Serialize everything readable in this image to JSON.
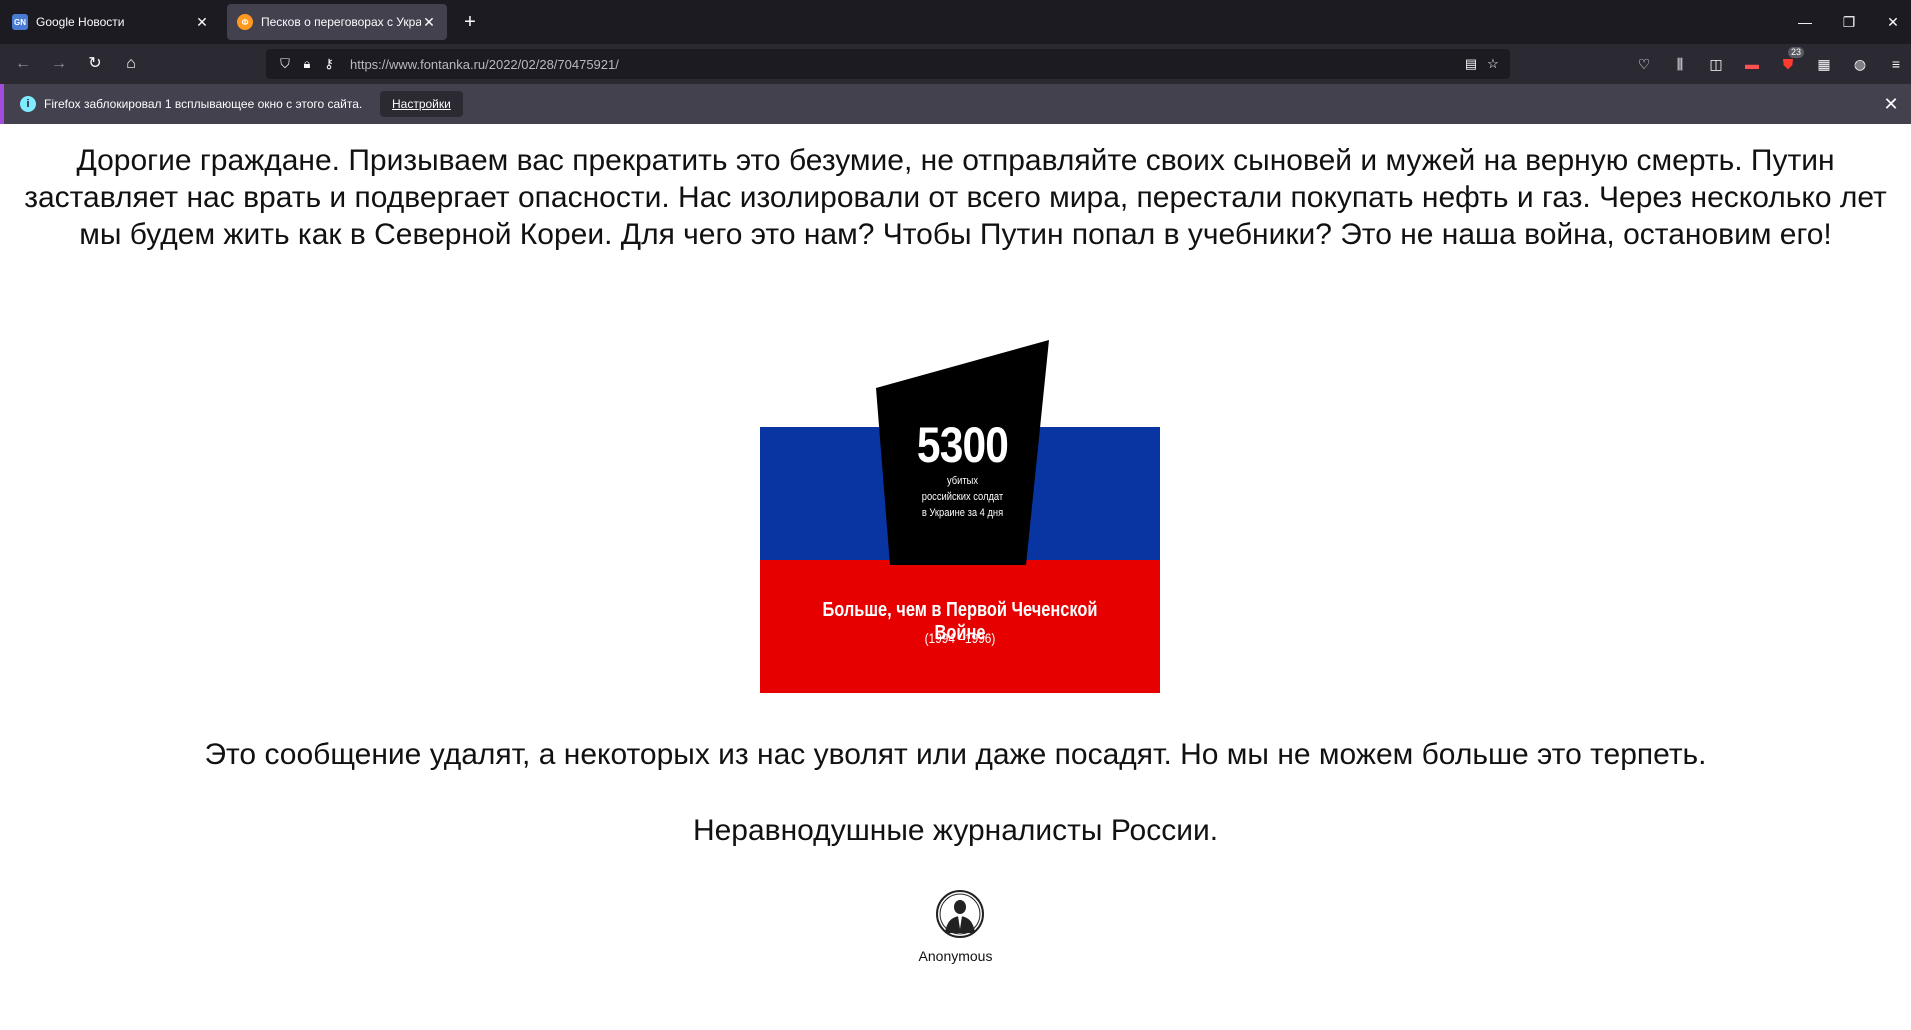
{
  "browser": {
    "tabs": [
      {
        "title": "Google Новости",
        "favicon": "google-news-icon",
        "active": false
      },
      {
        "title": "Песков о переговорах с Украиной",
        "favicon": "fontanka-icon",
        "active": true
      }
    ],
    "new_tab_icon": "plus-icon",
    "window_controls": [
      "minimize-icon",
      "restore-icon",
      "close-icon"
    ],
    "nav": {
      "back": "arrow-left-icon",
      "forward": "arrow-right-icon",
      "reload": "reload-icon",
      "home": "home-icon"
    },
    "url": "https://www.fontanka.ru/2022/02/28/70475921/",
    "extension_badge": "23",
    "notification": {
      "text": "Firefox заблокировал 1 всплывающее окно с этого сайта.",
      "button": "Настройки"
    }
  },
  "page": {
    "appeal": "Дорогие граждане. Призываем вас прекратить это безумие, не отправляйте своих сыновей и мужей на верную смерть. Путин заставляет нас врать и подвергает опасности. Нас изолировали от всего мира, перестали покупать нефть и газ. Через несколько лет мы будем жить как в Северной Кореи. Для чего это нам? Чтобы Путин попал в учебники? Это не наша война, остановим его!",
    "graphic": {
      "cross": "†",
      "number": "5300",
      "caption_lines": [
        "убитых",
        "российских солдат",
        "в Украине за 4 дня"
      ],
      "red_text": "Больше, чем в Первой Чеченской Войне",
      "red_subtext": "(1994 –1996)",
      "colors": {
        "blue": "#0935a3",
        "red": "#e60000",
        "stone": "#000000"
      }
    },
    "paragraph2": "Это сообщение удалят, а некоторых из нас уволят или даже посадят. Но мы не можем больше это терпеть.",
    "signature": "Неравнодушные журналисты России.",
    "logo_label": "Anonymous"
  }
}
